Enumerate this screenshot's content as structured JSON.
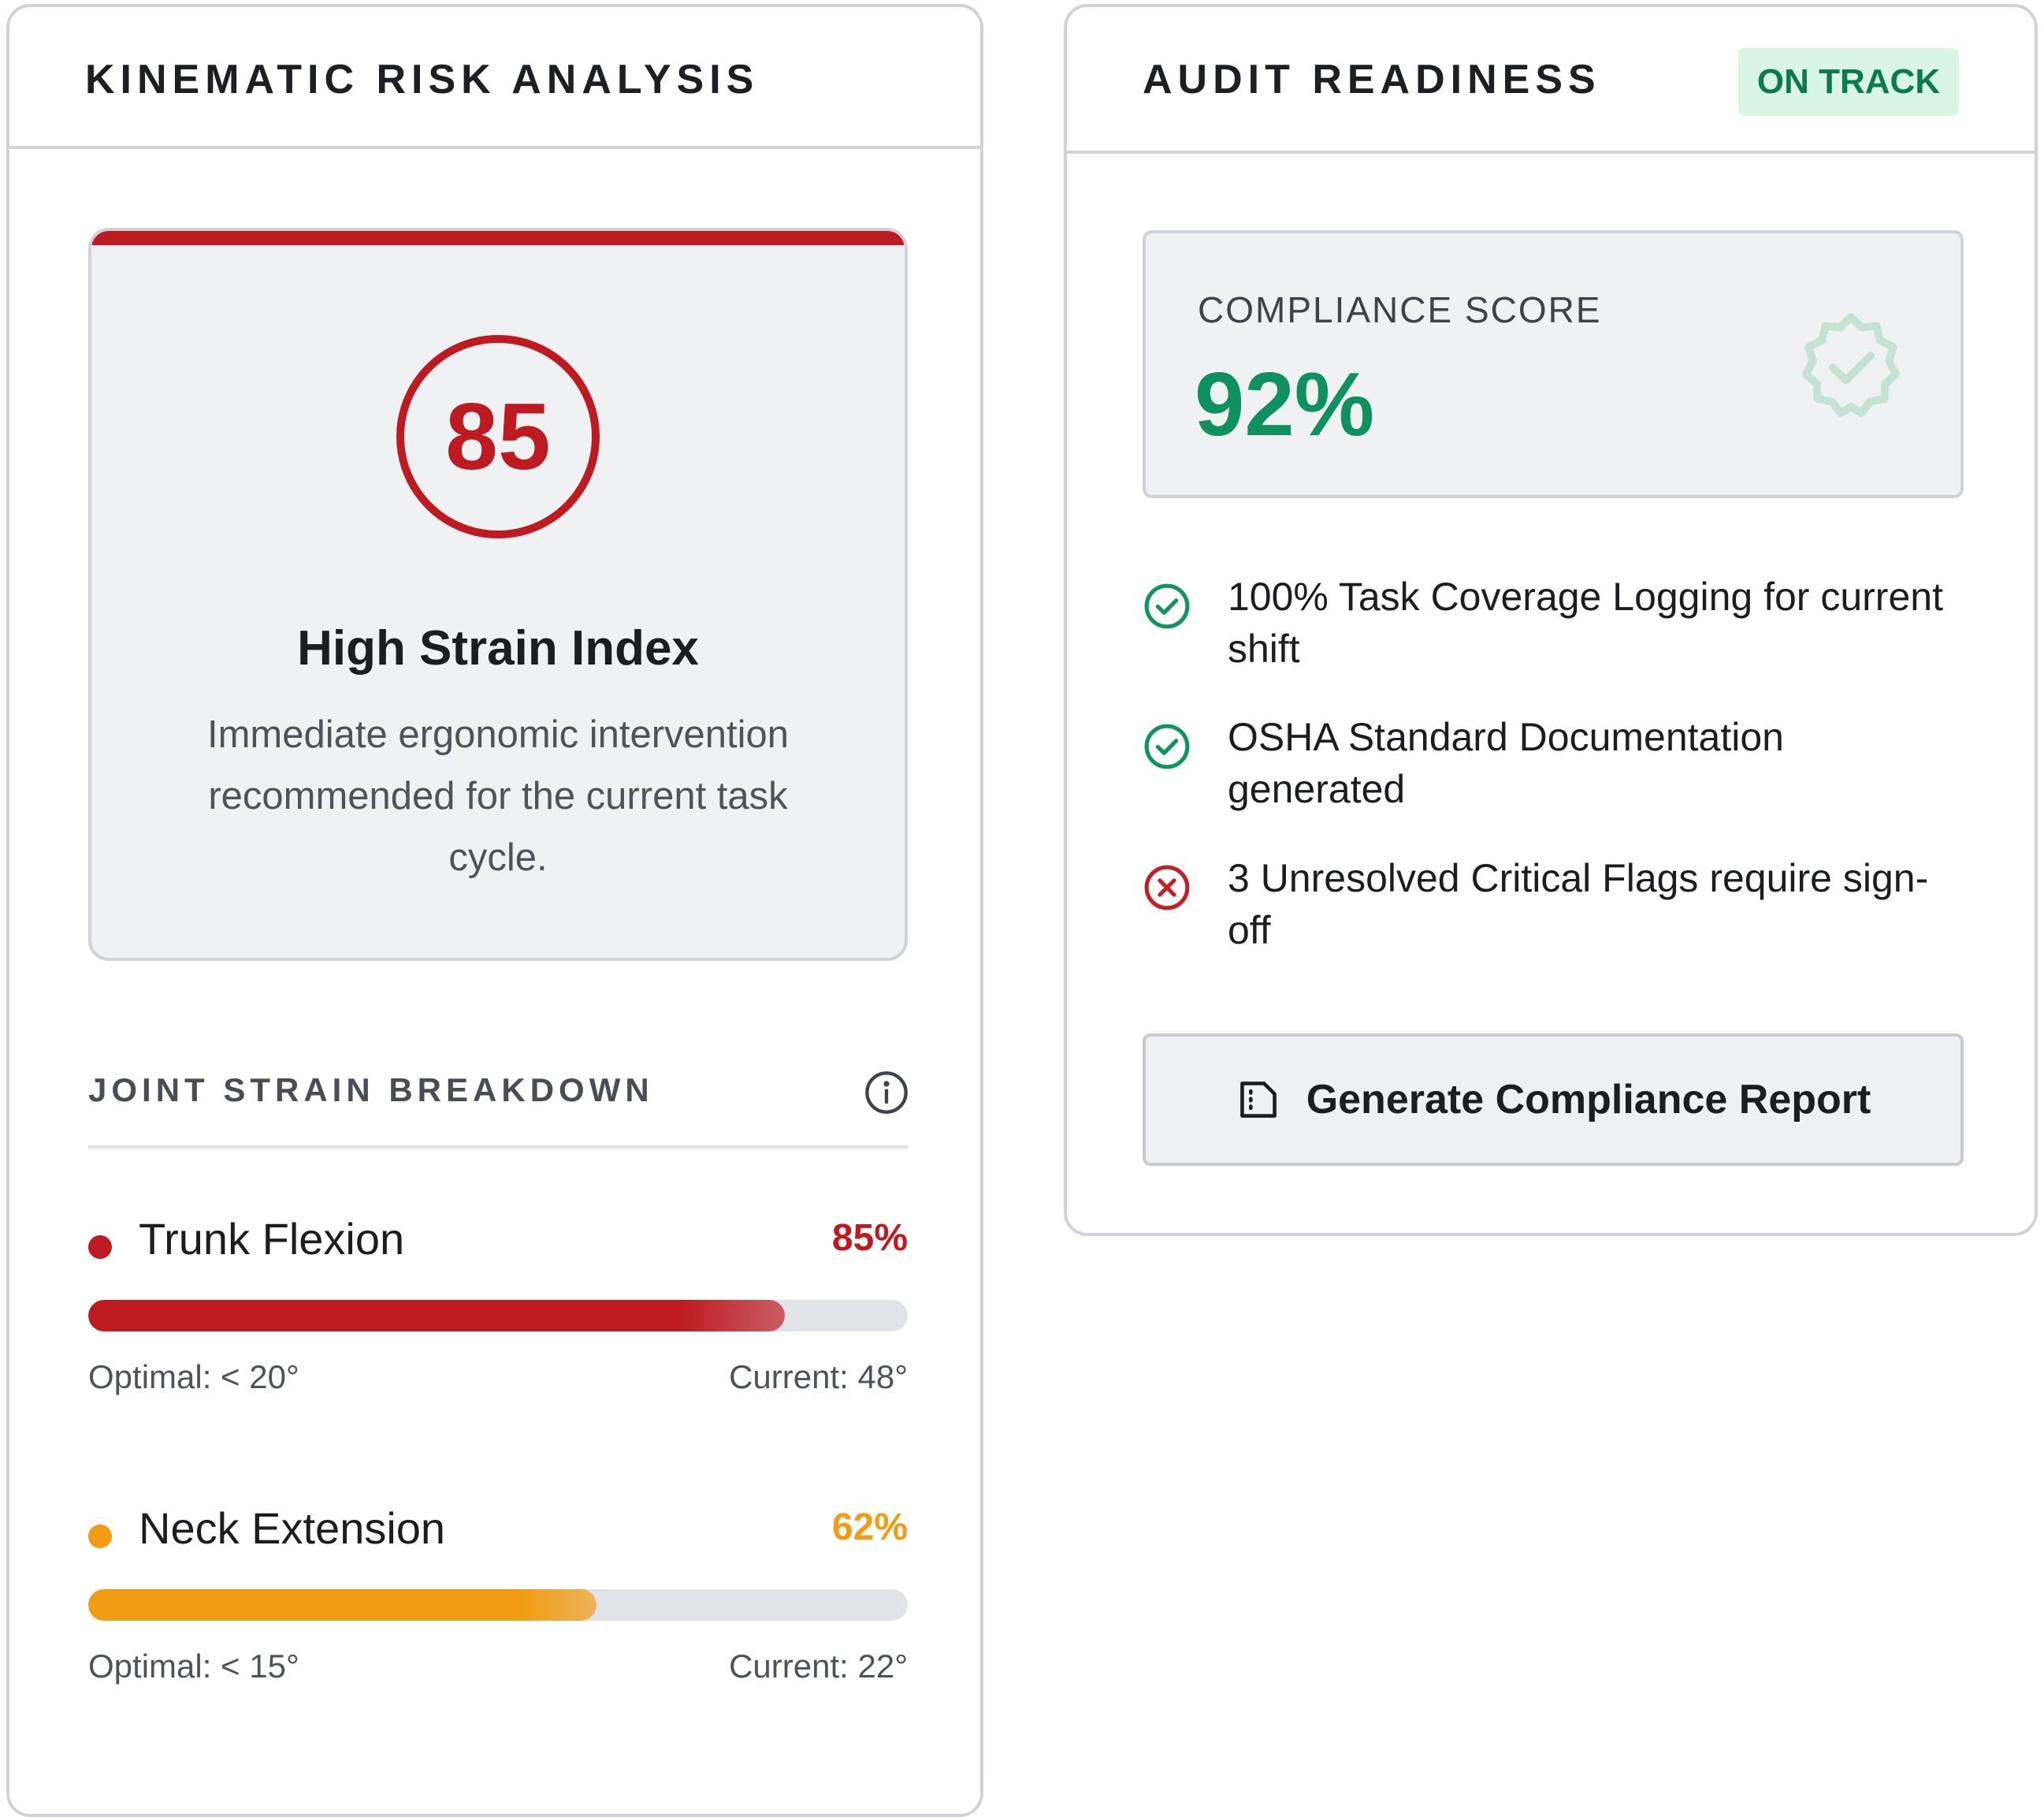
{
  "kinematic": {
    "title": "KINEMATIC RISK ANALYSIS",
    "score": "85",
    "strain_title": "High Strain Index",
    "strain_description": "Immediate ergonomic intervention recommended for the current task cycle.",
    "accent_color": "#bd1b21",
    "breakdown_title": "JOINT STRAIN BREAKDOWN",
    "info_icon": "info-icon",
    "joints": [
      {
        "name": "Trunk Flexion",
        "percent": "85%",
        "level": 0.85,
        "optimal": "Optimal: < 20°",
        "current": "Current: 48°",
        "color": "#bd1b21"
      },
      {
        "name": "Neck Extension",
        "percent": "62%",
        "level": 0.62,
        "optimal": "Optimal: < 15°",
        "current": "Current: 22°",
        "color": "#f19c12"
      }
    ]
  },
  "audit": {
    "title": "AUDIT READINESS",
    "badge": "ON TRACK",
    "badge_color": "#0d7a4c",
    "score_label": "COMPLIANCE SCORE",
    "score_value": "92%",
    "score_color": "#0f9060",
    "seal_icon": "verified-seal-icon",
    "checklist": [
      {
        "text": "100% Task Coverage Logging for current shift",
        "status": "complete",
        "icon": "check-circle-icon"
      },
      {
        "text": "OSHA Standard Documentation generated",
        "status": "complete",
        "icon": "check-circle-icon"
      },
      {
        "text": "3 Unresolved Critical Flags require sign-off",
        "status": "failed",
        "icon": "x-circle-icon"
      }
    ],
    "report_button_label": "Generate Compliance Report",
    "report_button_icon": "document-icon"
  }
}
